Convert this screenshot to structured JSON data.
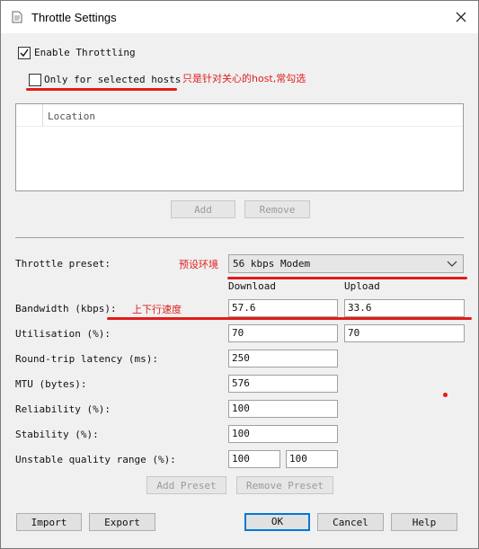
{
  "window": {
    "title": "Throttle Settings"
  },
  "enable_throttling": {
    "label": "Enable Throttling",
    "checked": true
  },
  "only_selected_hosts": {
    "label": "Only for selected hosts",
    "checked": false
  },
  "annotations": {
    "hosts_note": "只是针对关心的host,常勾选",
    "preset_note": "预设环境",
    "bandwidth_note": "上下行速度",
    "color": "#e02020"
  },
  "hosts_table": {
    "column": "Location",
    "rows": []
  },
  "hosts_buttons": {
    "add": "Add",
    "remove": "Remove"
  },
  "preset": {
    "label": "Throttle preset:",
    "value": "56 kbps Modem"
  },
  "columns": {
    "download": "Download",
    "upload": "Upload"
  },
  "fields": {
    "bandwidth": {
      "label": "Bandwidth (kbps):",
      "download": "57.6",
      "upload": "33.6"
    },
    "utilisation": {
      "label": "Utilisation (%):",
      "download": "70",
      "upload": "70"
    },
    "latency": {
      "label": "Round-trip latency (ms):",
      "value": "250"
    },
    "mtu": {
      "label": "MTU (bytes):",
      "value": "576"
    },
    "reliability": {
      "label": "Reliability (%):",
      "value": "100"
    },
    "stability": {
      "label": "Stability (%):",
      "value": "100"
    },
    "unstable": {
      "label": "Unstable quality range (%):",
      "min": "100",
      "max": "100"
    }
  },
  "preset_buttons": {
    "add": "Add Preset",
    "remove": "Remove Preset"
  },
  "footer": {
    "import": "Import",
    "export": "Export",
    "ok": "OK",
    "cancel": "Cancel",
    "help": "Help"
  },
  "icons": {
    "app": "document-icon",
    "close": "close-icon",
    "check": "checkmark-icon",
    "dropdown": "chevron-down-icon"
  }
}
